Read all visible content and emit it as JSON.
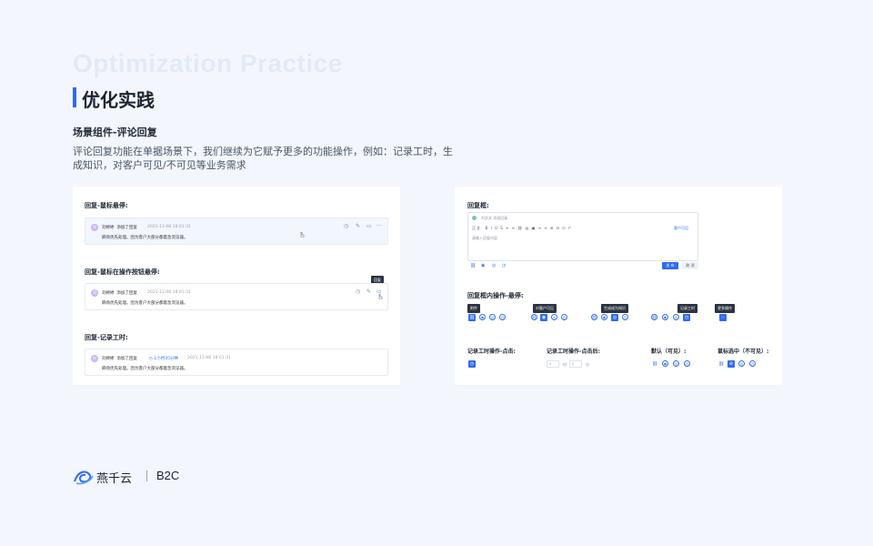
{
  "ghost_title": "Optimization Practice",
  "title": "优化实践",
  "subtitle": "场景组件-评论回复",
  "description": "评论回复功能在单据场景下，我们继续为它赋予更多的功能操作，例如：记录工时，生成知识，对客户可见/不可见等业务需求",
  "left_card": {
    "section1": "回复-鼠标悬停:",
    "section2": "回复-鼠标在操作按钮悬停:",
    "section3": "回复-记录工时:",
    "avatar_text": "刘",
    "user": "刘婷婷",
    "action": "添加了回复",
    "time": "2021-11-08 18:01:31",
    "content": "麻烦优先处理。因为客户大部分都着急浏览器。",
    "tooltip": "回复",
    "duration": "1小时35分钟"
  },
  "right_card": {
    "reply_box_label": "回复框:",
    "recipients": "刘文文  添加回复",
    "toolbar_label": "正文",
    "toolbar_icons": "B I U S ≡ ≡ ⛓ ▤ ▣ ≡ ≡ ⊞ ⊟ ⊡ ↶",
    "customer_visible": "客户可见",
    "placeholder": "请输入回复内容",
    "send": "发 布",
    "cancel": "取 消",
    "hover_label": "回复框内操作-悬停:",
    "tips": [
      "附件",
      "对客户可见",
      "生成成为知识",
      "记录工时",
      "更多操作"
    ],
    "worktime_click": "记录工时操作-点击:",
    "worktime_after": "记录工时操作-点击后:",
    "default_visible": "默认（可见）:",
    "selected_invisible": "鼠标选中（不可见）:",
    "hour_unit": "时",
    "minute_unit": "分",
    "hour_value": "0",
    "minute_value": "0"
  },
  "footer": {
    "brand": "燕千云",
    "product": "B2C"
  },
  "colors": {
    "accent": "#2f6bf0",
    "background": "#f3f7fd"
  }
}
